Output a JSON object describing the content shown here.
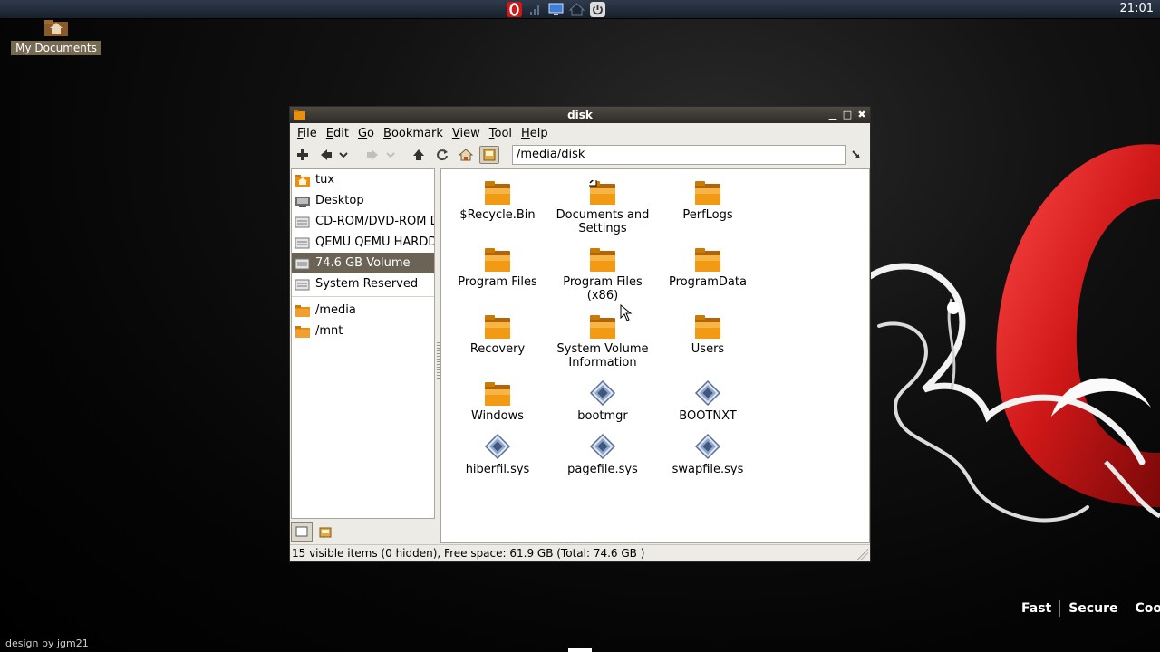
{
  "panel": {
    "clock": "21:01",
    "tray": [
      "opera-icon",
      "network-signal-icon",
      "monitor-icon",
      "home-icon",
      "power-icon"
    ]
  },
  "desktop": {
    "icon_label": "My Documents",
    "tagline": [
      "Fast",
      "Secure",
      "Cool"
    ],
    "credit": "design by jgm21"
  },
  "window": {
    "title": "disk",
    "menu": [
      {
        "label_u": "F",
        "label_rest": "ile"
      },
      {
        "label_u": "E",
        "label_rest": "dit"
      },
      {
        "label_u": "G",
        "label_rest": "o"
      },
      {
        "label_u": "B",
        "label_rest": "ookmark"
      },
      {
        "label_u": "V",
        "label_rest": "iew"
      },
      {
        "label_u": "T",
        "label_rest": "ool"
      },
      {
        "label_u": "H",
        "label_rest": "elp"
      }
    ],
    "path": "/media/disk",
    "sidebar": [
      {
        "label": "tux",
        "icon": "home-folder-icon"
      },
      {
        "label": "Desktop",
        "icon": "desktop-icon"
      },
      {
        "label": "CD-ROM/DVD-ROM Dri",
        "icon": "drive-icon"
      },
      {
        "label": "QEMU QEMU HARDDIS",
        "icon": "drive-icon"
      },
      {
        "label": "74.6 GB Volume",
        "icon": "drive-icon",
        "selected": true
      },
      {
        "label": "System Reserved",
        "icon": "drive-icon"
      },
      {
        "label": "/media",
        "icon": "folder-icon"
      },
      {
        "label": "/mnt",
        "icon": "folder-icon"
      }
    ],
    "files": [
      {
        "name": "$Recycle.Bin",
        "icon": "folder-icon"
      },
      {
        "name": "Documents and Settings",
        "icon": "folder-link-icon"
      },
      {
        "name": "PerfLogs",
        "icon": "folder-icon"
      },
      {
        "name": "Program Files",
        "icon": "folder-icon"
      },
      {
        "name": "Program Files (x86)",
        "icon": "folder-icon"
      },
      {
        "name": "ProgramData",
        "icon": "folder-icon"
      },
      {
        "name": "Recovery",
        "icon": "folder-icon"
      },
      {
        "name": "System Volume Information",
        "icon": "folder-icon"
      },
      {
        "name": "Users",
        "icon": "folder-icon"
      },
      {
        "name": "Windows",
        "icon": "folder-icon"
      },
      {
        "name": "bootmgr",
        "icon": "system-file-icon"
      },
      {
        "name": "BOOTNXT",
        "icon": "system-file-icon"
      },
      {
        "name": "hiberfil.sys",
        "icon": "system-file-icon"
      },
      {
        "name": "pagefile.sys",
        "icon": "system-file-icon"
      },
      {
        "name": "swapfile.sys",
        "icon": "system-file-icon"
      }
    ],
    "status": "15 visible items (0 hidden), Free space: 61.9 GB (Total: 74.6 GB )"
  },
  "colors": {
    "selection": "#6b6456",
    "folder": "#e8900c",
    "titlebar": "#3b3833",
    "opera_red": "#d01818"
  }
}
